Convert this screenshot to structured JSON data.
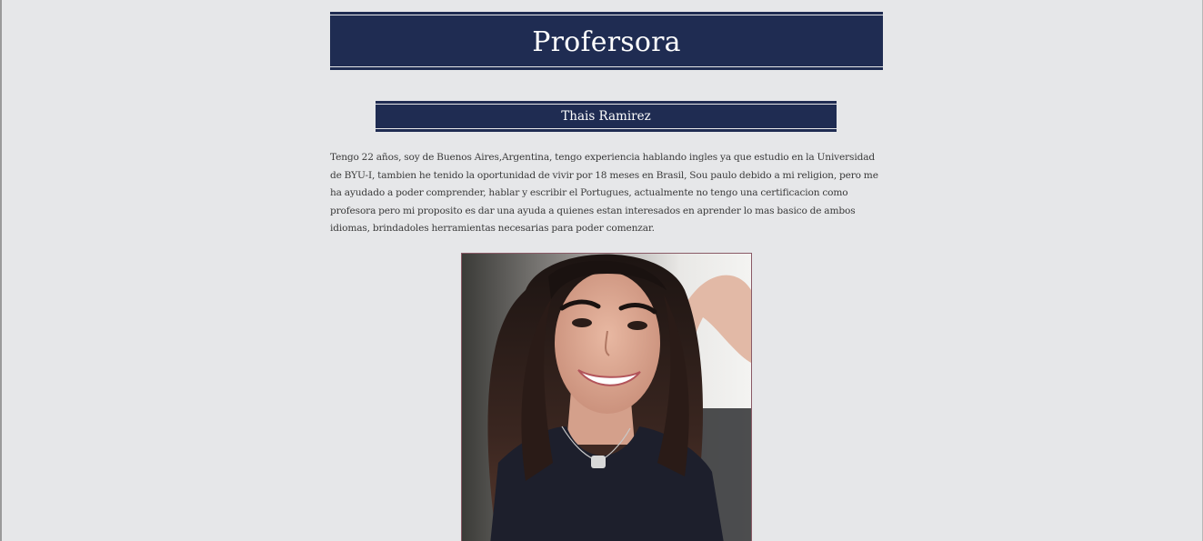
{
  "page": {
    "title": "Profersora"
  },
  "teacher": {
    "name": "Thais Ramirez",
    "bio": "Tengo 22 años, soy de Buenos Aires,Argentina, tengo experiencia hablando ingles ya que estudio en la Universidad de BYU-I, tambien he tenido la oportunidad de vivir por 18 meses en Brasil, Sou paulo debido a mi religion, pero me ha ayudado a poder comprender, hablar y escribir el Portugues, actualmente no tengo una certificacion como profesora pero mi proposito es dar una ayuda a quienes estan interesados en aprender lo mas basico de ambos idiomas, brindadoles herramientas necesarias para poder comenzar."
  },
  "colors": {
    "page_background": "#e6e7e9",
    "banner": "#1f2c52",
    "banner_text": "#ffffff",
    "body_text": "#3a3a3a",
    "photo_border": "#8a5a66"
  }
}
